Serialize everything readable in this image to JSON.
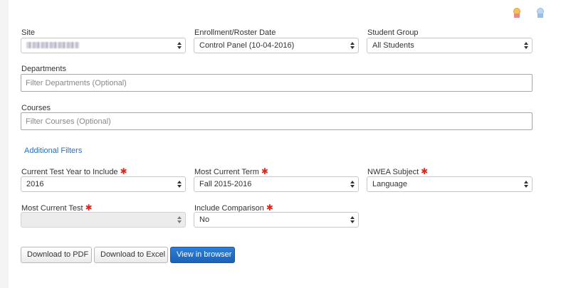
{
  "fields": {
    "site": {
      "label": "Site",
      "value": ""
    },
    "roster_date": {
      "label": "Enrollment/Roster Date",
      "value": "Control Panel (10-04-2016)"
    },
    "student_group": {
      "label": "Student Group",
      "value": "All Students"
    },
    "departments": {
      "label": "Departments",
      "placeholder": "Filter Departments (Optional)"
    },
    "courses": {
      "label": "Courses",
      "placeholder": "Filter Courses (Optional)"
    },
    "test_year": {
      "label": "Current Test Year to Include",
      "value": "2016"
    },
    "current_term": {
      "label": "Most Current Term",
      "value": "Fall 2015-2016"
    },
    "nwea_subject": {
      "label": "NWEA Subject",
      "value": "Language"
    },
    "current_test": {
      "label": "Most Current Test",
      "value": ""
    },
    "comparison": {
      "label": "Include Comparison",
      "value": "No"
    }
  },
  "required_marker": "✱",
  "additional_filters": "Additional Filters",
  "buttons": {
    "pdf": "Download to PDF",
    "excel": "Download to Excel",
    "browser": "View in browser"
  },
  "icons": [
    "award-ribbon-gold-icon",
    "award-ribbon-blue-icon"
  ]
}
